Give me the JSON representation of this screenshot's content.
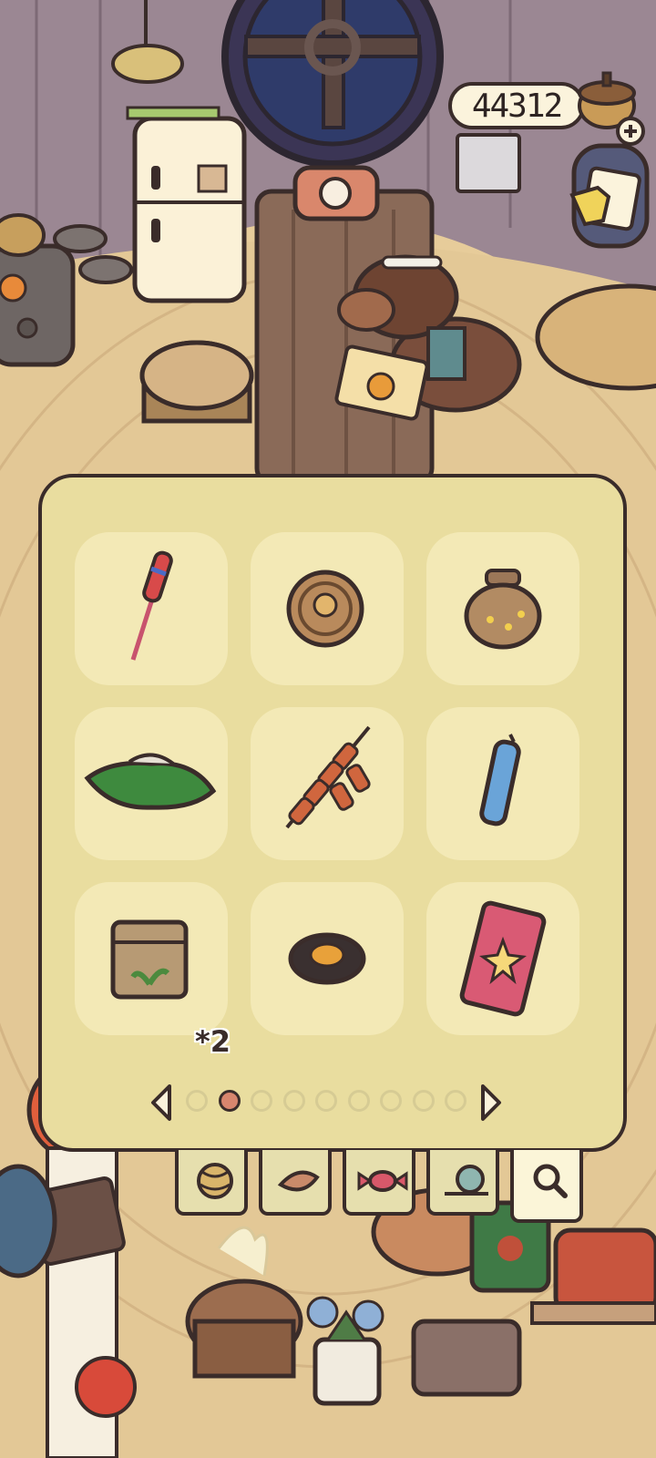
{
  "hud": {
    "coin_count": "44312",
    "coin_icon": "acorn-coin-plus-icon",
    "hint_icon": "pointing-hand-note-icon"
  },
  "inventory": {
    "items": [
      {
        "name": "firework-rocket",
        "icon": "firework-rocket-icon",
        "quantity": ""
      },
      {
        "name": "round-cookie",
        "icon": "cookie-icon",
        "quantity": ""
      },
      {
        "name": "clay-jar",
        "icon": "jar-icon",
        "quantity": ""
      },
      {
        "name": "green-wrapped-bundle",
        "icon": "bundle-icon",
        "quantity": ""
      },
      {
        "name": "firecracker-string",
        "icon": "firecracker-icon",
        "quantity": ""
      },
      {
        "name": "blue-firecracker",
        "icon": "blue-cracker-icon",
        "quantity": ""
      },
      {
        "name": "seed-bag",
        "icon": "seed-bag-icon",
        "quantity": "*2"
      },
      {
        "name": "straw-hat",
        "icon": "hat-icon",
        "quantity": ""
      },
      {
        "name": "firework-box",
        "icon": "firework-box-icon",
        "quantity": ""
      }
    ],
    "pager": {
      "total_pages": 9,
      "current_page": 2
    }
  },
  "tabs": [
    {
      "name": "yarn",
      "icon": "yarn-ball-icon",
      "active": false
    },
    {
      "name": "leaf",
      "icon": "leaf-icon",
      "active": false
    },
    {
      "name": "candy",
      "icon": "candy-icon",
      "active": false
    },
    {
      "name": "snail",
      "icon": "snail-icon",
      "active": false
    },
    {
      "name": "search",
      "icon": "magnifier-icon",
      "active": true
    }
  ],
  "colors": {
    "panel": "#e9dd9f",
    "slot": "#f3e9b6",
    "outline": "#3a2c2a",
    "active_dot": "#d8866e"
  }
}
